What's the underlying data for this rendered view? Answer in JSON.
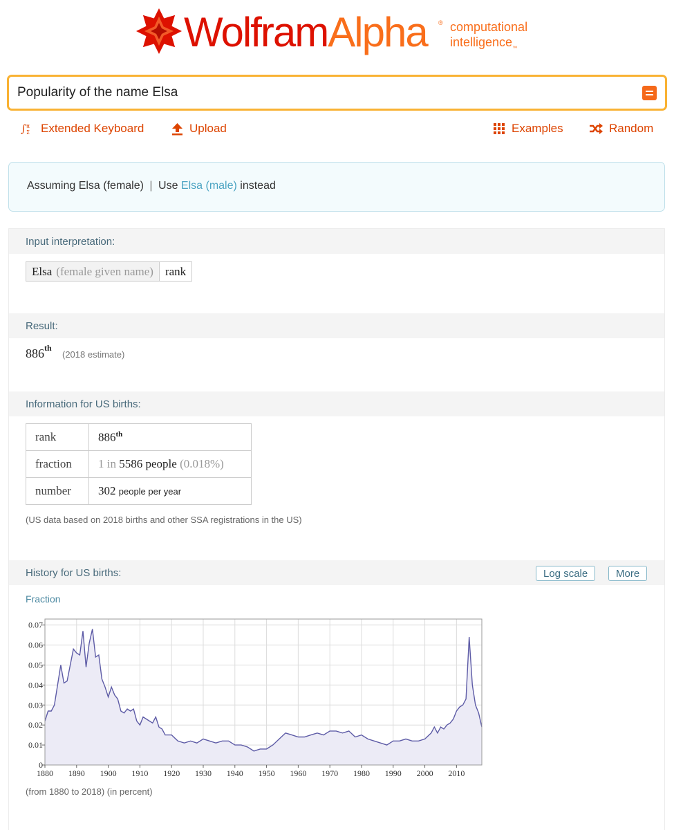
{
  "logo": {
    "word1": "Wolfram",
    "word2": "Alpha",
    "reg": "®",
    "tag_line1": "computational",
    "tag_line2": "intelligence",
    "tm": "™"
  },
  "search": {
    "value": "Popularity of the name Elsa"
  },
  "toolbar": {
    "keyboard": "Extended Keyboard",
    "upload": "Upload",
    "examples": "Examples",
    "random": "Random"
  },
  "assumption": {
    "prefix": "Assuming Elsa (female)",
    "separator": "|",
    "use": "Use",
    "alternative": "Elsa (male)",
    "suffix": "instead"
  },
  "pods": {
    "interpretation": {
      "title": "Input interpretation:",
      "name": "Elsa",
      "hint": "(female given name)",
      "property": "rank"
    },
    "result": {
      "title": "Result:",
      "value": "886",
      "suffix": "th",
      "note": "(2018 estimate)"
    },
    "info": {
      "title": "Information for US births:",
      "rows": [
        {
          "label": "rank",
          "value": "886",
          "suffix": "th"
        },
        {
          "label": "fraction",
          "pre": "1 in",
          "value": "5586",
          "unit": "people",
          "extra": "(0.018%)"
        },
        {
          "label": "number",
          "value": "302",
          "unit": "people per year"
        }
      ],
      "note": "(US data based on 2018 births and other SSA registrations in the US)"
    },
    "history": {
      "title": "History for US births:",
      "log_button": "Log scale",
      "more_button": "More",
      "fraction_label": "Fraction",
      "note": "(from 1880 to 2018)  (in percent)"
    }
  },
  "chart_data": {
    "type": "area",
    "title": "",
    "xlabel": "",
    "ylabel": "",
    "xlim": [
      1880,
      2018
    ],
    "ylim": [
      0,
      0.073
    ],
    "x_ticks": [
      "1880",
      "1890",
      "1900",
      "1910",
      "1920",
      "1930",
      "1940",
      "1950",
      "1960",
      "1970",
      "1980",
      "1990",
      "2000",
      "2010"
    ],
    "y_ticks": [
      "0",
      "0.01",
      "0.02",
      "0.03",
      "0.04",
      "0.05",
      "0.06",
      "0.07"
    ],
    "grid": true,
    "line_color": "#5d5ba6",
    "fill_color": "#ecebf6",
    "series": [
      {
        "x": [
          1880,
          1881,
          1882,
          1883,
          1884,
          1885,
          1886,
          1887,
          1888,
          1889,
          1890,
          1891,
          1892,
          1893,
          1894,
          1895,
          1896,
          1897,
          1898,
          1899,
          1900,
          1901,
          1902,
          1903,
          1904,
          1905,
          1906,
          1907,
          1908,
          1909,
          1910,
          1911,
          1912,
          1913,
          1914,
          1915,
          1916,
          1917,
          1918,
          1919,
          1920,
          1922,
          1924,
          1926,
          1928,
          1930,
          1932,
          1934,
          1936,
          1938,
          1940,
          1942,
          1944,
          1946,
          1948,
          1950,
          1952,
          1954,
          1956,
          1958,
          1960,
          1962,
          1964,
          1966,
          1968,
          1970,
          1972,
          1974,
          1976,
          1978,
          1980,
          1982,
          1984,
          1986,
          1988,
          1990,
          1992,
          1994,
          1996,
          1998,
          2000,
          2002,
          2003,
          2004,
          2005,
          2006,
          2007,
          2008,
          2009,
          2010,
          2011,
          2012,
          2013,
          2014,
          2015,
          2016,
          2017,
          2018
        ],
        "values": [
          0.022,
          0.027,
          0.027,
          0.03,
          0.04,
          0.05,
          0.041,
          0.042,
          0.05,
          0.058,
          0.056,
          0.055,
          0.067,
          0.049,
          0.061,
          0.068,
          0.054,
          0.055,
          0.043,
          0.039,
          0.034,
          0.039,
          0.035,
          0.033,
          0.027,
          0.026,
          0.028,
          0.027,
          0.028,
          0.022,
          0.02,
          0.024,
          0.023,
          0.022,
          0.021,
          0.024,
          0.019,
          0.018,
          0.015,
          0.015,
          0.015,
          0.012,
          0.011,
          0.012,
          0.011,
          0.013,
          0.012,
          0.011,
          0.012,
          0.012,
          0.01,
          0.01,
          0.009,
          0.007,
          0.008,
          0.008,
          0.01,
          0.013,
          0.016,
          0.015,
          0.014,
          0.014,
          0.015,
          0.016,
          0.015,
          0.017,
          0.017,
          0.016,
          0.017,
          0.014,
          0.015,
          0.013,
          0.012,
          0.011,
          0.01,
          0.012,
          0.012,
          0.013,
          0.012,
          0.012,
          0.013,
          0.016,
          0.019,
          0.016,
          0.019,
          0.018,
          0.02,
          0.021,
          0.023,
          0.027,
          0.029,
          0.03,
          0.033,
          0.064,
          0.04,
          0.03,
          0.026,
          0.019
        ]
      }
    ]
  }
}
